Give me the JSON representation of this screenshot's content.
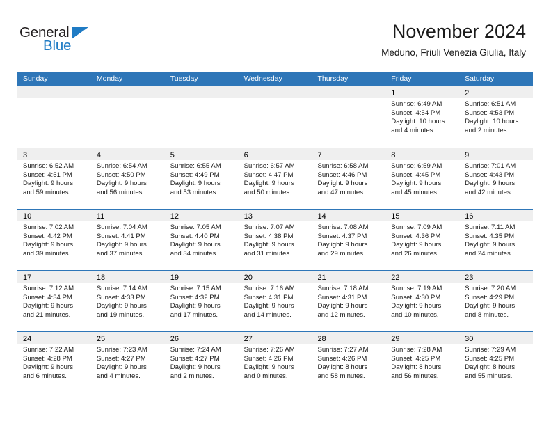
{
  "brand": {
    "name_dark": "General",
    "name_blue": "Blue",
    "triangle_icon": "triangle-logo-icon",
    "accent_color": "#1f7bc4"
  },
  "header": {
    "title": "November 2024",
    "subtitle": "Meduno, Friuli Venezia Giulia, Italy"
  },
  "theme": {
    "header_blue": "#2e76b8",
    "day_band_gray": "#efefef",
    "text_color": "#1a1a1a"
  },
  "weekdays": [
    "Sunday",
    "Monday",
    "Tuesday",
    "Wednesday",
    "Thursday",
    "Friday",
    "Saturday"
  ],
  "weeks": [
    [
      {
        "day": "",
        "empty": true,
        "lines": []
      },
      {
        "day": "",
        "empty": true,
        "lines": []
      },
      {
        "day": "",
        "empty": true,
        "lines": []
      },
      {
        "day": "",
        "empty": true,
        "lines": []
      },
      {
        "day": "",
        "empty": true,
        "lines": []
      },
      {
        "day": "1",
        "empty": false,
        "lines": [
          "Sunrise: 6:49 AM",
          "Sunset: 4:54 PM",
          "Daylight: 10 hours",
          "and 4 minutes."
        ]
      },
      {
        "day": "2",
        "empty": false,
        "lines": [
          "Sunrise: 6:51 AM",
          "Sunset: 4:53 PM",
          "Daylight: 10 hours",
          "and 2 minutes."
        ]
      }
    ],
    [
      {
        "day": "3",
        "empty": false,
        "lines": [
          "Sunrise: 6:52 AM",
          "Sunset: 4:51 PM",
          "Daylight: 9 hours",
          "and 59 minutes."
        ]
      },
      {
        "day": "4",
        "empty": false,
        "lines": [
          "Sunrise: 6:54 AM",
          "Sunset: 4:50 PM",
          "Daylight: 9 hours",
          "and 56 minutes."
        ]
      },
      {
        "day": "5",
        "empty": false,
        "lines": [
          "Sunrise: 6:55 AM",
          "Sunset: 4:49 PM",
          "Daylight: 9 hours",
          "and 53 minutes."
        ]
      },
      {
        "day": "6",
        "empty": false,
        "lines": [
          "Sunrise: 6:57 AM",
          "Sunset: 4:47 PM",
          "Daylight: 9 hours",
          "and 50 minutes."
        ]
      },
      {
        "day": "7",
        "empty": false,
        "lines": [
          "Sunrise: 6:58 AM",
          "Sunset: 4:46 PM",
          "Daylight: 9 hours",
          "and 47 minutes."
        ]
      },
      {
        "day": "8",
        "empty": false,
        "lines": [
          "Sunrise: 6:59 AM",
          "Sunset: 4:45 PM",
          "Daylight: 9 hours",
          "and 45 minutes."
        ]
      },
      {
        "day": "9",
        "empty": false,
        "lines": [
          "Sunrise: 7:01 AM",
          "Sunset: 4:43 PM",
          "Daylight: 9 hours",
          "and 42 minutes."
        ]
      }
    ],
    [
      {
        "day": "10",
        "empty": false,
        "lines": [
          "Sunrise: 7:02 AM",
          "Sunset: 4:42 PM",
          "Daylight: 9 hours",
          "and 39 minutes."
        ]
      },
      {
        "day": "11",
        "empty": false,
        "lines": [
          "Sunrise: 7:04 AM",
          "Sunset: 4:41 PM",
          "Daylight: 9 hours",
          "and 37 minutes."
        ]
      },
      {
        "day": "12",
        "empty": false,
        "lines": [
          "Sunrise: 7:05 AM",
          "Sunset: 4:40 PM",
          "Daylight: 9 hours",
          "and 34 minutes."
        ]
      },
      {
        "day": "13",
        "empty": false,
        "lines": [
          "Sunrise: 7:07 AM",
          "Sunset: 4:38 PM",
          "Daylight: 9 hours",
          "and 31 minutes."
        ]
      },
      {
        "day": "14",
        "empty": false,
        "lines": [
          "Sunrise: 7:08 AM",
          "Sunset: 4:37 PM",
          "Daylight: 9 hours",
          "and 29 minutes."
        ]
      },
      {
        "day": "15",
        "empty": false,
        "lines": [
          "Sunrise: 7:09 AM",
          "Sunset: 4:36 PM",
          "Daylight: 9 hours",
          "and 26 minutes."
        ]
      },
      {
        "day": "16",
        "empty": false,
        "lines": [
          "Sunrise: 7:11 AM",
          "Sunset: 4:35 PM",
          "Daylight: 9 hours",
          "and 24 minutes."
        ]
      }
    ],
    [
      {
        "day": "17",
        "empty": false,
        "lines": [
          "Sunrise: 7:12 AM",
          "Sunset: 4:34 PM",
          "Daylight: 9 hours",
          "and 21 minutes."
        ]
      },
      {
        "day": "18",
        "empty": false,
        "lines": [
          "Sunrise: 7:14 AM",
          "Sunset: 4:33 PM",
          "Daylight: 9 hours",
          "and 19 minutes."
        ]
      },
      {
        "day": "19",
        "empty": false,
        "lines": [
          "Sunrise: 7:15 AM",
          "Sunset: 4:32 PM",
          "Daylight: 9 hours",
          "and 17 minutes."
        ]
      },
      {
        "day": "20",
        "empty": false,
        "lines": [
          "Sunrise: 7:16 AM",
          "Sunset: 4:31 PM",
          "Daylight: 9 hours",
          "and 14 minutes."
        ]
      },
      {
        "day": "21",
        "empty": false,
        "lines": [
          "Sunrise: 7:18 AM",
          "Sunset: 4:31 PM",
          "Daylight: 9 hours",
          "and 12 minutes."
        ]
      },
      {
        "day": "22",
        "empty": false,
        "lines": [
          "Sunrise: 7:19 AM",
          "Sunset: 4:30 PM",
          "Daylight: 9 hours",
          "and 10 minutes."
        ]
      },
      {
        "day": "23",
        "empty": false,
        "lines": [
          "Sunrise: 7:20 AM",
          "Sunset: 4:29 PM",
          "Daylight: 9 hours",
          "and 8 minutes."
        ]
      }
    ],
    [
      {
        "day": "24",
        "empty": false,
        "lines": [
          "Sunrise: 7:22 AM",
          "Sunset: 4:28 PM",
          "Daylight: 9 hours",
          "and 6 minutes."
        ]
      },
      {
        "day": "25",
        "empty": false,
        "lines": [
          "Sunrise: 7:23 AM",
          "Sunset: 4:27 PM",
          "Daylight: 9 hours",
          "and 4 minutes."
        ]
      },
      {
        "day": "26",
        "empty": false,
        "lines": [
          "Sunrise: 7:24 AM",
          "Sunset: 4:27 PM",
          "Daylight: 9 hours",
          "and 2 minutes."
        ]
      },
      {
        "day": "27",
        "empty": false,
        "lines": [
          "Sunrise: 7:26 AM",
          "Sunset: 4:26 PM",
          "Daylight: 9 hours",
          "and 0 minutes."
        ]
      },
      {
        "day": "28",
        "empty": false,
        "lines": [
          "Sunrise: 7:27 AM",
          "Sunset: 4:26 PM",
          "Daylight: 8 hours",
          "and 58 minutes."
        ]
      },
      {
        "day": "29",
        "empty": false,
        "lines": [
          "Sunrise: 7:28 AM",
          "Sunset: 4:25 PM",
          "Daylight: 8 hours",
          "and 56 minutes."
        ]
      },
      {
        "day": "30",
        "empty": false,
        "lines": [
          "Sunrise: 7:29 AM",
          "Sunset: 4:25 PM",
          "Daylight: 8 hours",
          "and 55 minutes."
        ]
      }
    ]
  ]
}
